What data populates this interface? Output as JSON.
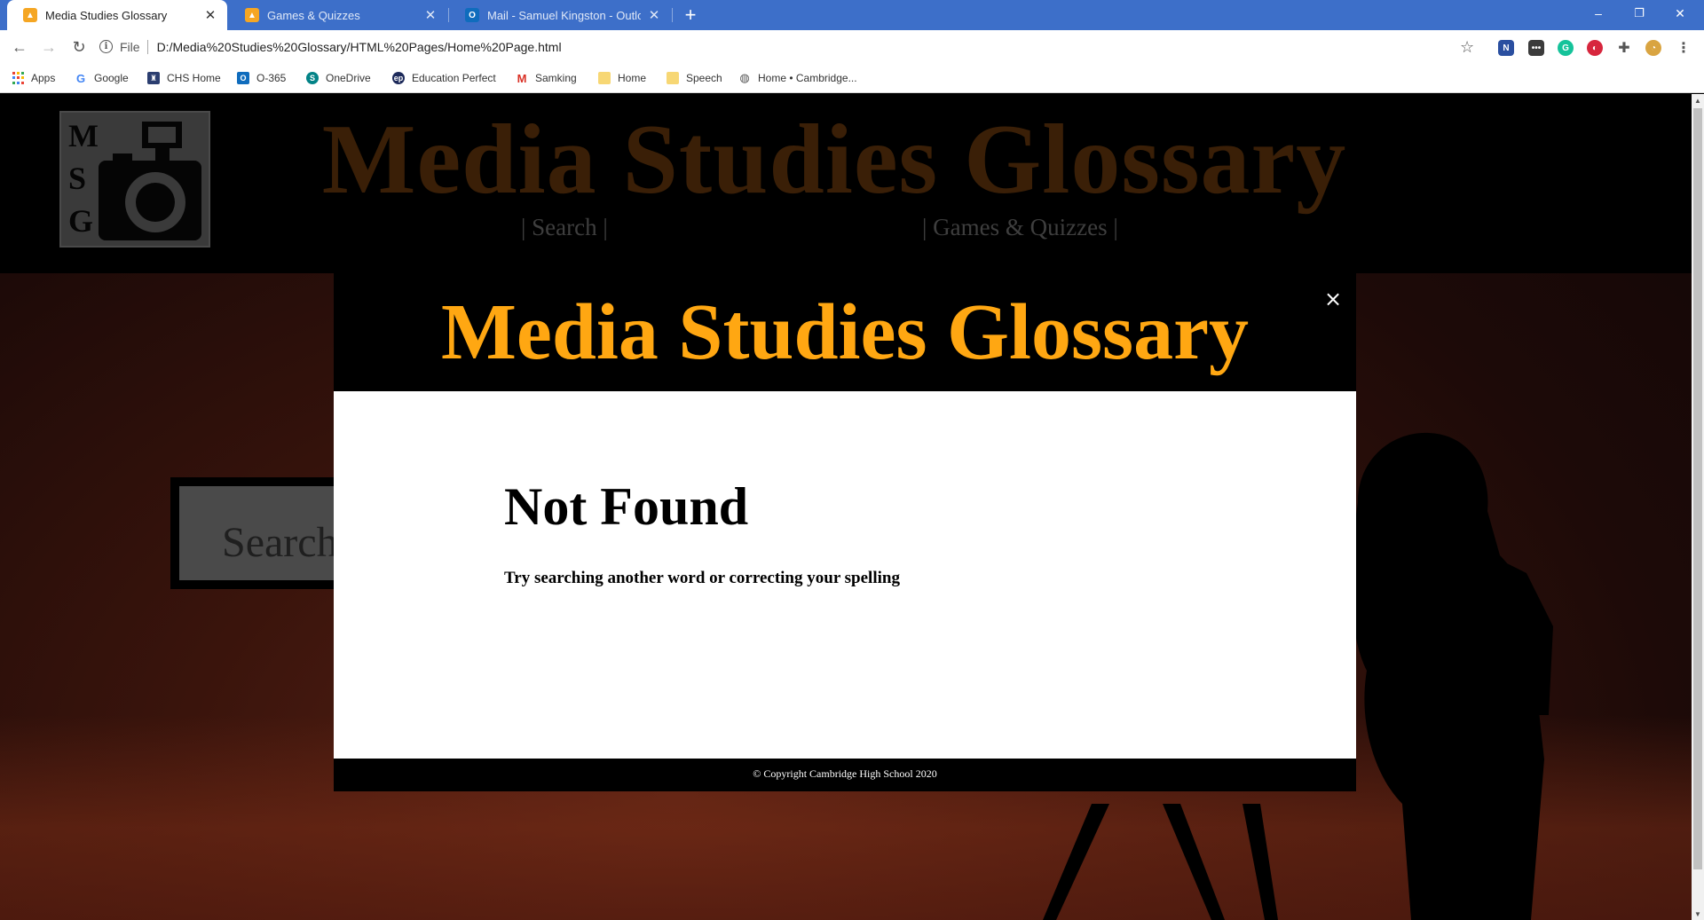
{
  "browser": {
    "tabs": [
      {
        "title": "Media Studies Glossary",
        "icon": "media-studies-favicon"
      },
      {
        "title": "Games & Quizzes",
        "icon": "games-favicon"
      },
      {
        "title": "Mail - Samuel Kingston - Outlook",
        "icon": "outlook-favicon"
      }
    ],
    "new_tab_label": "+",
    "window_controls": {
      "minimize": "–",
      "restore": "❐",
      "close": "✕"
    },
    "nav": {
      "back": "←",
      "forward": "→",
      "reload": "↻"
    },
    "address": {
      "scheme": "File",
      "url": "D:/Media%20Studies%20Glossary/HTML%20Pages/Home%20Page.html"
    },
    "bookmarks": [
      {
        "label": "Apps",
        "icon": "apps-grid-icon"
      },
      {
        "label": "Google",
        "icon": "google-icon"
      },
      {
        "label": "CHS Home",
        "icon": "chs-icon"
      },
      {
        "label": "O-365",
        "icon": "outlook-icon"
      },
      {
        "label": "OneDrive",
        "icon": "sharepoint-icon"
      },
      {
        "label": "Education Perfect",
        "icon": "education-perfect-icon"
      },
      {
        "label": "Samking",
        "icon": "gmail-icon"
      },
      {
        "label": "Home",
        "icon": "folder-icon"
      },
      {
        "label": "Speech",
        "icon": "folder-icon"
      },
      {
        "label": "Home • Cambridge...",
        "icon": "globe-icon"
      }
    ]
  },
  "site": {
    "header_title": "Media Studies Glossary",
    "logo_letters": [
      "M",
      "S",
      "G"
    ],
    "nav_links": [
      {
        "label": "| Search |"
      },
      {
        "label": "| Games & Quizzes |"
      }
    ],
    "search_placeholder": "Search"
  },
  "modal": {
    "title": "Media Studies Glossary",
    "close_label": "×",
    "heading": "Not Found",
    "message": "Try searching another word or correcting your spelling",
    "footer": "© Copyright Cambridge High School 2020"
  },
  "colors": {
    "modal_title": "#ffa712",
    "header_title_dim": "#3a1f07",
    "tab_strip": "#3d6fc9"
  }
}
